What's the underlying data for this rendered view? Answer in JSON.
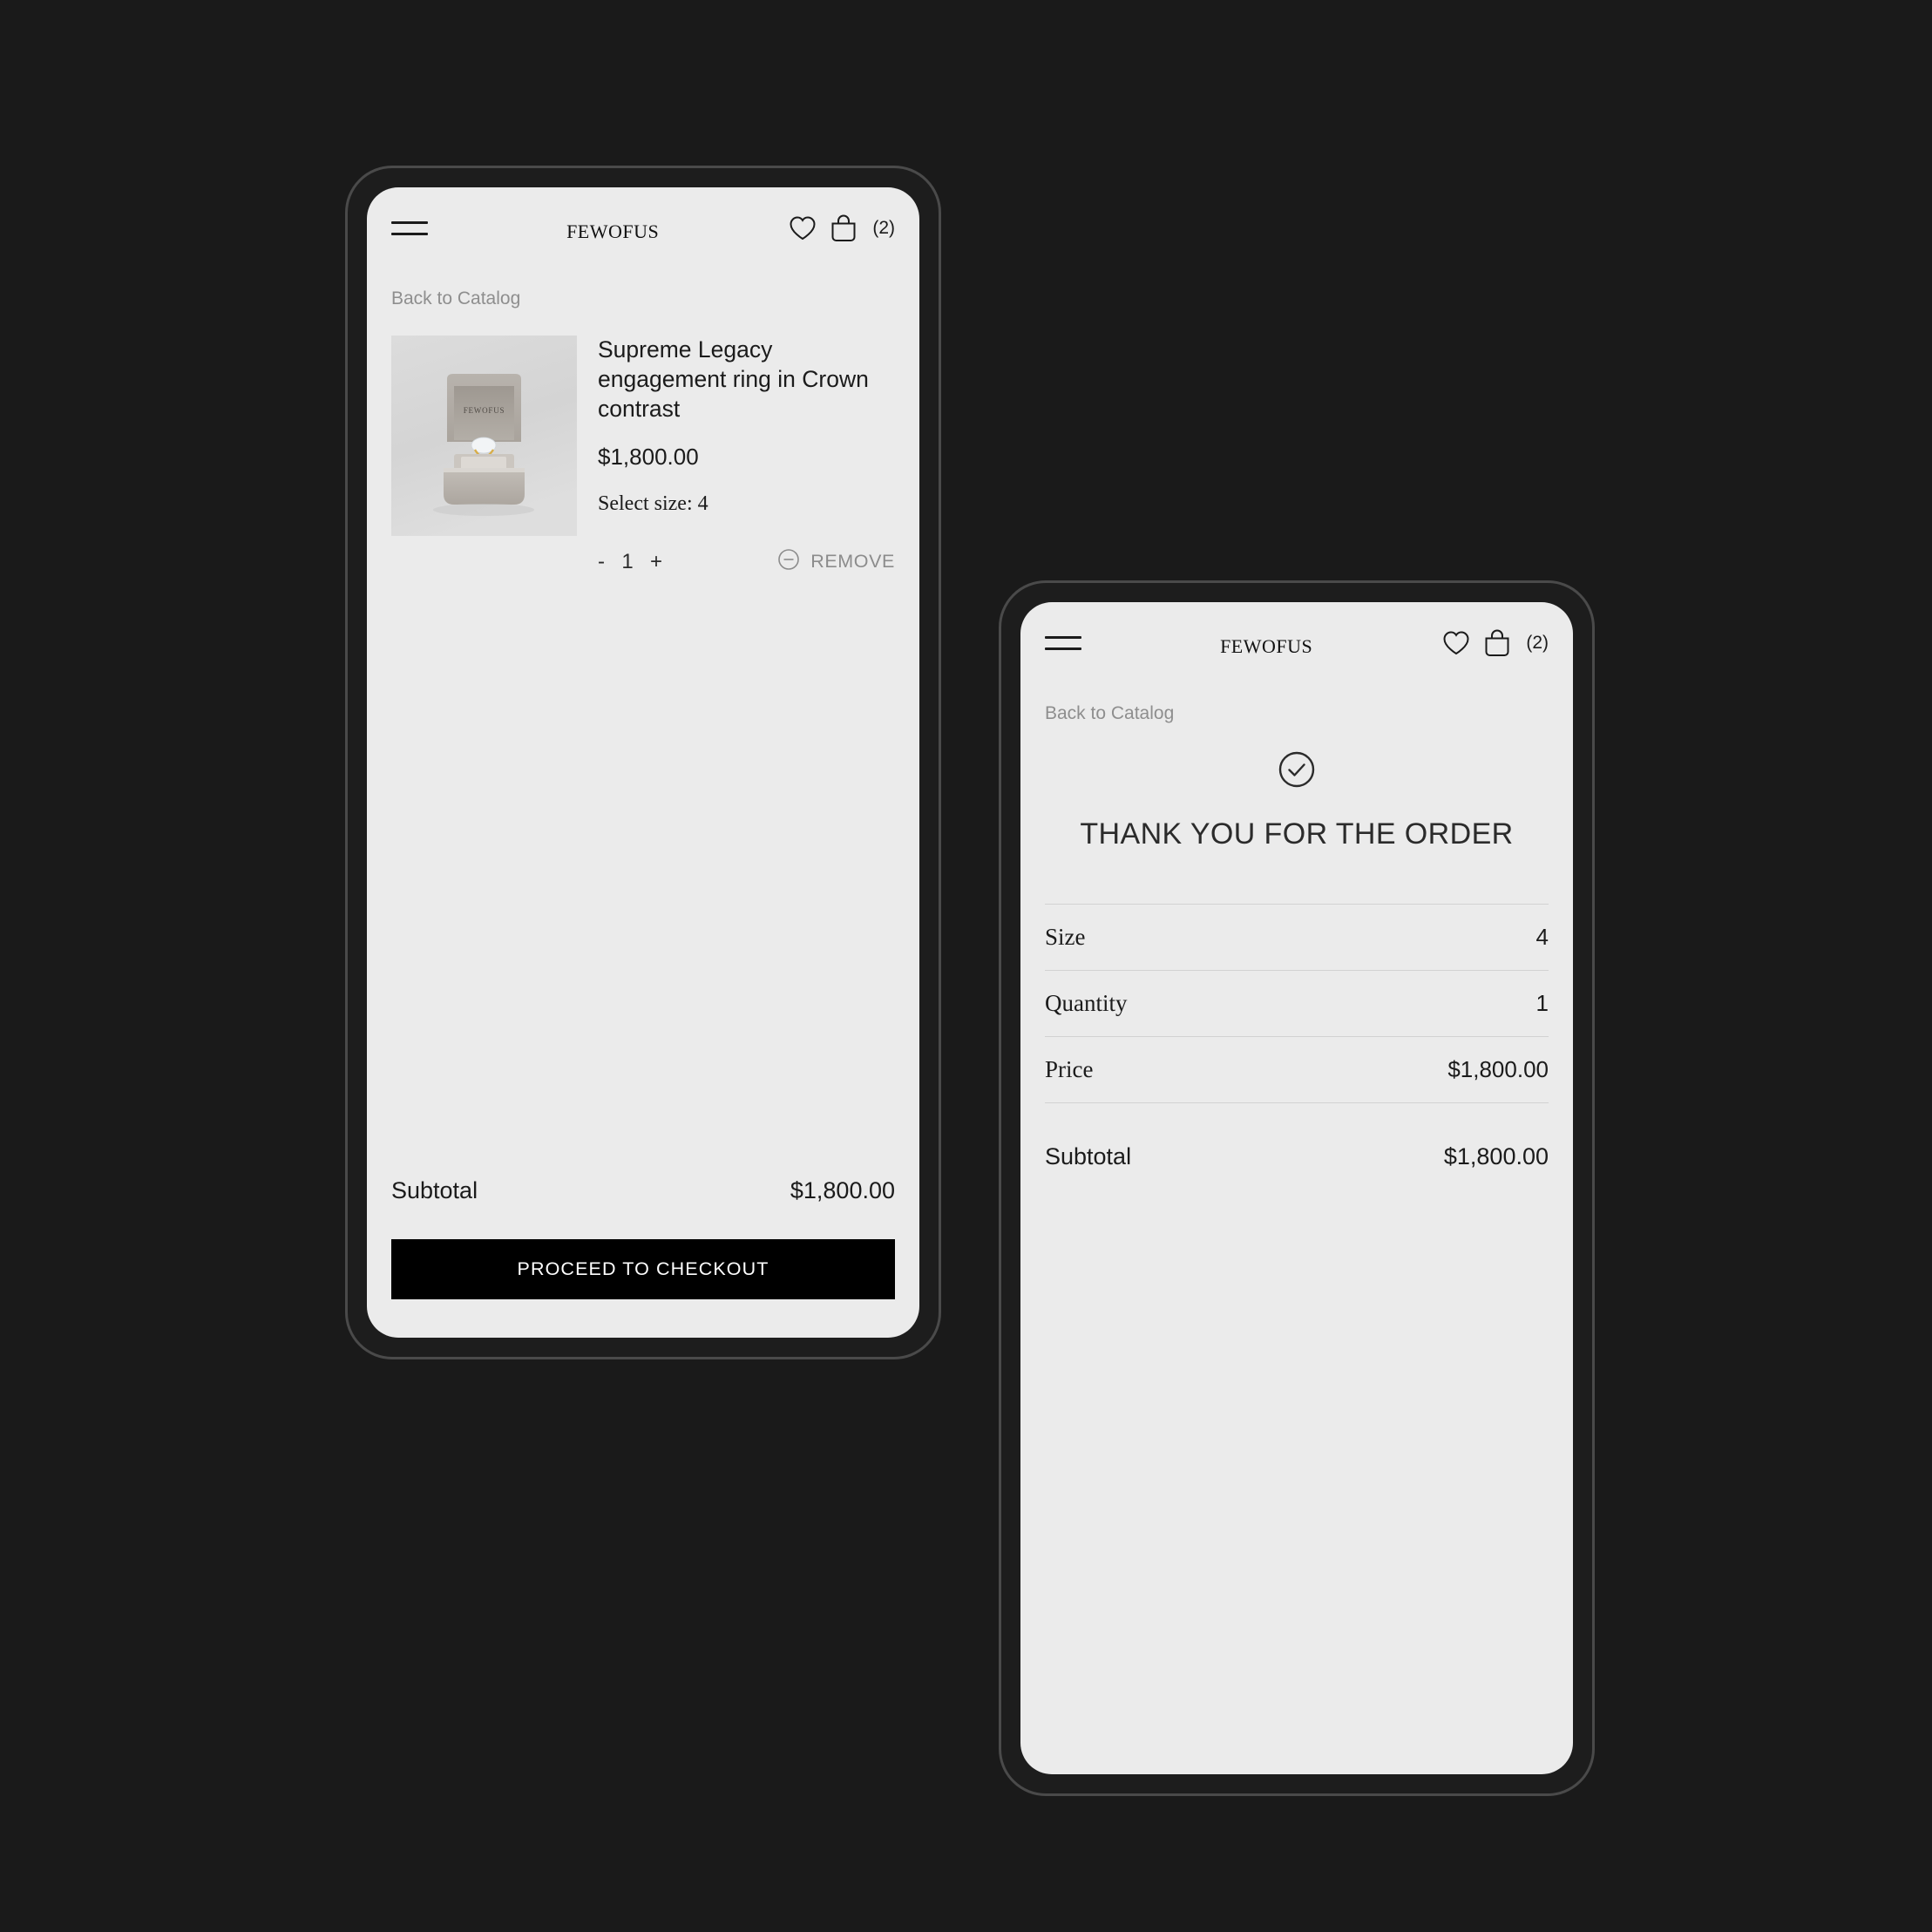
{
  "background_color": "#1a1a1a",
  "brand": {
    "name": "FewOfUs"
  },
  "header": {
    "menu_icon": "hamburger-menu-icon",
    "wishlist_icon": "heart-icon",
    "cart_icon": "shopping-bag-icon",
    "cart_count": "(2)"
  },
  "cart_screen": {
    "breadcrumb": "Back to Catalog",
    "item": {
      "image_alt": "ring-box-product-photo",
      "image_brand_stamp": "FewOfUs",
      "title": "Supreme Legacy engagement ring in Crown contrast",
      "price": "$1,800.00",
      "size_label": "Select size: 4",
      "decrement_label": "-",
      "quantity": "1",
      "increment_label": "+",
      "remove_label": "REMOVE",
      "remove_icon": "minus-circle-icon"
    },
    "subtotal_label": "Subtotal",
    "subtotal_value": "$1,800.00",
    "checkout_label": "PROCEED TO CHECKOUT"
  },
  "confirmation_screen": {
    "breadcrumb": "Back to Catalog",
    "success_icon": "check-circle-icon",
    "heading": "THANK YOU FOR THE ORDER",
    "summary": [
      {
        "label": "Size",
        "value": "4"
      },
      {
        "label": "Quantity",
        "value": "1"
      },
      {
        "label": "Price",
        "value": "$1,800.00"
      }
    ],
    "subtotal_label": "Subtotal",
    "subtotal_value": "$1,800.00"
  },
  "colors": {
    "screen_bg": "#ebebeb",
    "frame_bezel": "#1d1d1d",
    "frame_edge": "#4a4a4a",
    "button_bg": "#000000",
    "button_text": "#ffffff",
    "muted_text": "#8e8e8e",
    "primary_text": "#1b1b1b"
  }
}
